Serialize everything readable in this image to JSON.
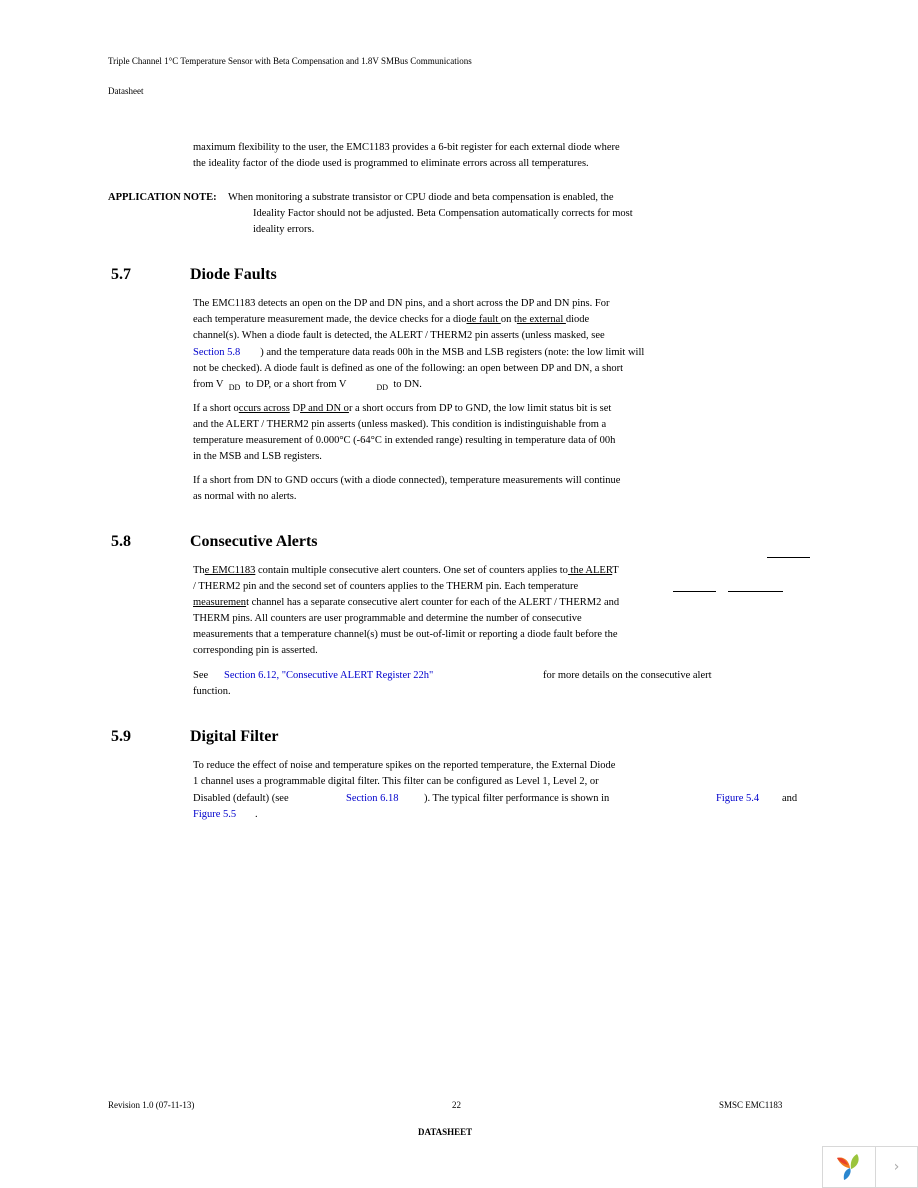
{
  "header": {
    "title": "Triple Channel 1°C Temperature Sensor with Beta Compensation and 1.8V SMBus Communications",
    "subtitle": "Datasheet"
  },
  "intro": {
    "lines": [
      "maximum flexibility to the user, the EMC1183 provides a 6-bit register for each external diode where",
      "the ideality factor of the diode used is programmed to eliminate errors across all temperatures."
    ]
  },
  "app_note": {
    "label": "APPLICATION NOTE:",
    "lines": [
      "When monitoring a substrate transistor or CPU diode and beta compensation is enabled, the",
      "Ideality Factor should not be adjusted. Beta Compensation automatically corrects for most",
      "ideality errors."
    ]
  },
  "sections": [
    {
      "number": "5.7",
      "title": "Diode Faults",
      "p1": {
        "l1": "The EMC1183 detects an open on the DP and DN pins, and a short across the DP and DN pins. For",
        "l2a": "each temperature measurement made, the device checks for a dio",
        "l2b": "de fault ",
        "l2c": "on t",
        "l2d": "he external ",
        "l2e": "diode",
        "l3": "channel(s). When a diode fault is detected, the ALERT / THERM2 pin asserts (unless masked, see",
        "l4_link": "Section 5.8",
        "l4": ") and the temperature data reads 00h in the MSB and LSB registers (note: the low limit will",
        "l5": "not be checked). A diode fault is defined as one of the following: an open between DP and DN, a short",
        "l6a": "from V",
        "l6sub": "DD",
        "l6b": "to DP, or a short from V",
        "l6c": "to DN."
      },
      "p2": {
        "l1a": "If a short o",
        "l1b": "ccurs across",
        "l1c": " D",
        "l1d": "P and DN o",
        "l1e": "r a short occurs from DP to GND, the low limit status bit is set",
        "l2": "and the ALERT  /  THERM2 pin asserts (unless masked). This condition is indistinguishable from a",
        "l3": "temperature measurement of 0.000°C (-64°C in extended range) resulting in temperature data of 00h",
        "l4": "in the MSB and LSB registers."
      },
      "p3": {
        "l1": "If a short from DN to GND occurs (with a diode connected), temperature measurements will continue",
        "l2": "as normal with no alerts."
      }
    },
    {
      "number": "5.8",
      "title": "Consecutive Alerts",
      "p1": {
        "l1a": "Th",
        "l1b": "e EMC1183",
        "l1c": " contain multiple consecutive alert counters. One set of counters applies to",
        "l1d": " the ALER",
        "l1e": "T",
        "l2": "/  THERM2 pin and the second set of counters applies to the THERM pin. Each temperature",
        "l3a": "measuremen",
        "l3b": "t channel has a separate consecutive alert counter for each of the ALERT / THERM2 and",
        "l4": "THERM pins. All counters are user programmable and determine the number of consecutive",
        "l5": "measurements that a temperature channel(s) must be out-of-limit or reporting a diode fault before the",
        "l6": "corresponding pin is asserted."
      },
      "p2": {
        "see": "See",
        "link": "Section 6.12, \"Consecutive ALERT Register 22h\"",
        "rest": "for more details on the consecutive alert",
        "l2": "function."
      }
    },
    {
      "number": "5.9",
      "title": "Digital Filter",
      "p1": {
        "l1": "To reduce the effect of noise and temperature spikes on the reported temperature, the External Diode",
        "l2": "1 channel uses a programmable digital filter. This filter can be configured as Level 1, Level 2, or",
        "l3a": "Disabled (default) (see",
        "l3_link": "Section 6.18",
        "l3b": "). The typical filter performance is shown in",
        "l3_link2": "Figure 5.4",
        "l3c": "and",
        "l4_link": "Figure 5.5",
        "l4": "."
      }
    }
  ],
  "footer": {
    "revision": "Revision 1.0 (07-11-13)",
    "page": "22",
    "product": "SMSC EMC1183",
    "label": "DATASHEET"
  },
  "widget": {
    "logo_icon": "yii-logo-icon",
    "next_glyph": "›"
  }
}
